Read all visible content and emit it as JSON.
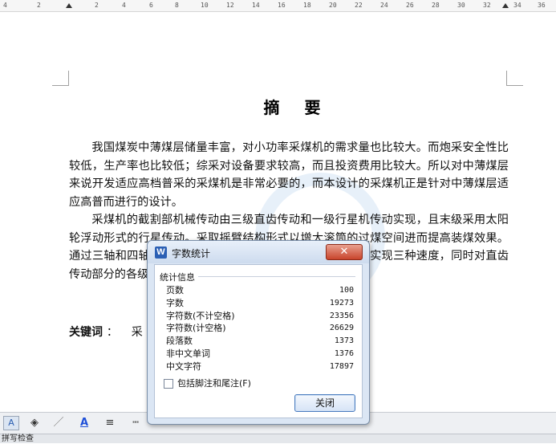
{
  "ruler": {
    "labels": [
      "4",
      "2",
      "2",
      "4",
      "6",
      "8",
      "10",
      "12",
      "14",
      "16",
      "18",
      "20",
      "22",
      "24",
      "26",
      "28",
      "30",
      "32",
      "34",
      "36"
    ]
  },
  "document": {
    "title": "摘 要",
    "paragraph1": "我国煤炭中薄煤层储量丰富，对小功率采煤机的需求量也比较大。而炮采安全性比较低，生产率也比较低；综采对设备要求较高，而且投资费用比较大。所以对中薄煤层来说开发适应高档普采的采煤机是非常必要的，而本设计的采煤机正是针对中薄煤层适应高普而进行的设计。",
    "paragraph2": "采煤机的截割部机械传动由三级直齿传动和一级行星机传动实现，且末级采用太阳轮浮动形式的行星传动。采取摇臂结构形式以增大滚筒的过煤空间进而提高装煤效果。通过三轴和四轴惰轮组件的更换三轴和四轴相应配对齿轮可实现三种速度，同时对直齿传动部分的各级直齿齿轮及相应的传动轴进行了设计计算。",
    "keywords_label": "关键词",
    "keywords_colon": "：",
    "keywords_value": "采"
  },
  "dialog": {
    "icon_letter": "W",
    "title": "字数统计",
    "close_glyph": "✕",
    "section_title": "统计信息",
    "stats": [
      {
        "label": "页数",
        "value": "100"
      },
      {
        "label": "字数",
        "value": "19273"
      },
      {
        "label": "字符数(不计空格)",
        "value": "23356"
      },
      {
        "label": "字符数(计空格)",
        "value": "26629"
      },
      {
        "label": "段落数",
        "value": "1373"
      },
      {
        "label": "非中文单词",
        "value": "1376"
      },
      {
        "label": "中文字符",
        "value": "17897"
      }
    ],
    "include_footnotes_label": "包括脚注和尾注(F)",
    "include_footnotes_checked": false,
    "close_button_label": "关闭"
  },
  "toolbar": {
    "buttons": [
      {
        "name": "text-icon",
        "glyph": "A"
      },
      {
        "name": "fill-color-icon",
        "glyph": "◈"
      },
      {
        "name": "line-color-icon",
        "glyph": "／"
      },
      {
        "name": "font-color-icon",
        "glyph": "A"
      },
      {
        "name": "line-style-icon",
        "glyph": "≡"
      },
      {
        "name": "dash-style-icon",
        "glyph": "┅"
      }
    ],
    "font_color": "#1e4fd8"
  },
  "statusbar": {
    "text": "拼写检查"
  }
}
